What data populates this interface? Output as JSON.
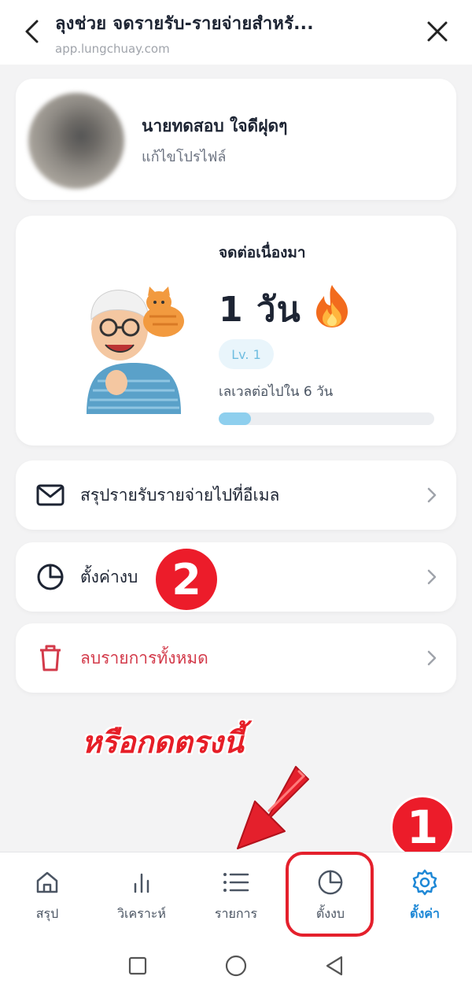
{
  "header": {
    "title": "ลุงช่วย จดรายรับ-รายจ่ายสำหรั...",
    "url": "app.lungchuay.com"
  },
  "profile": {
    "name": "นายทดสอบ ใจดีฝุดๆ",
    "edit_label": "แก้ไขโปรไฟล์"
  },
  "streak": {
    "label": "จดต่อเนื่องมา",
    "value": "1 วัน",
    "level_badge": "Lv. 1",
    "next_level_text": "เลเวลต่อไปใน 6 วัน",
    "progress_percent": 15
  },
  "menu": {
    "email_summary": "สรุปรายรับรายจ่ายไปที่อีเมล",
    "set_budget": "ตั้งค่างบ",
    "delete_all": "ลบรายการทั้งหมด"
  },
  "annotations": {
    "step_2": "2",
    "step_1": "1",
    "hint": "หรือกดตรงนี้"
  },
  "tabs": [
    {
      "label": "สรุป",
      "icon": "home-icon"
    },
    {
      "label": "วิเคราะห์",
      "icon": "bar-chart-icon"
    },
    {
      "label": "รายการ",
      "icon": "list-icon"
    },
    {
      "label": "ตั้งงบ",
      "icon": "pie-chart-icon"
    },
    {
      "label": "ตั้งค่า",
      "icon": "gear-icon",
      "active": true
    }
  ],
  "colors": {
    "accent": "#1e88d6",
    "danger": "#d33a4a",
    "annotation_red": "#ec1c2a",
    "progress": "#8ecfee"
  }
}
